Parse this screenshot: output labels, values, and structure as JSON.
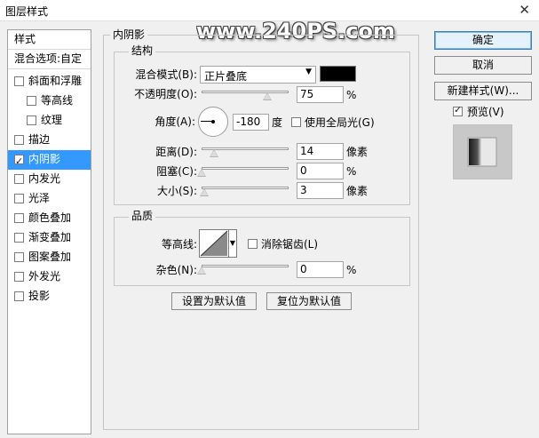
{
  "window": {
    "title": "图层样式",
    "close_glyph": "✕"
  },
  "watermark": "www.240PS.com",
  "left_panel": {
    "header": "样式",
    "blend_options": "混合选项:自定",
    "items": [
      {
        "label": "斜面和浮雕",
        "checked": false
      },
      {
        "label": "等高线",
        "checked": false
      },
      {
        "label": "纹理",
        "checked": false
      },
      {
        "label": "描边",
        "checked": false
      },
      {
        "label": "内阴影",
        "checked": true
      },
      {
        "label": "内发光",
        "checked": false
      },
      {
        "label": "光泽",
        "checked": false
      },
      {
        "label": "颜色叠加",
        "checked": false
      },
      {
        "label": "渐变叠加",
        "checked": false
      },
      {
        "label": "图案叠加",
        "checked": false
      },
      {
        "label": "外发光",
        "checked": false
      },
      {
        "label": "投影",
        "checked": false
      }
    ]
  },
  "inner_shadow": {
    "title": "内阴影",
    "structure": {
      "title": "结构",
      "blend_mode_label": "混合模式(B):",
      "blend_mode_value": "正片叠底",
      "shadow_color": "#000000",
      "opacity_label": "不透明度(O):",
      "opacity_value": "75",
      "opacity_unit": "%",
      "angle_label": "角度(A):",
      "angle_value": "-180",
      "angle_unit": "度",
      "global_light_label": "使用全局光(G)",
      "distance_label": "距离(D):",
      "distance_value": "14",
      "distance_unit": "像素",
      "choke_label": "阻塞(C):",
      "choke_value": "0",
      "choke_unit": "%",
      "size_label": "大小(S):",
      "size_value": "3",
      "size_unit": "像素"
    },
    "quality": {
      "title": "品质",
      "contour_label": "等高线:",
      "antialias_label": "消除锯齿(L)",
      "noise_label": "杂色(N):",
      "noise_value": "0",
      "noise_unit": "%"
    },
    "make_default": "设置为默认值",
    "reset_default": "复位为默认值"
  },
  "right_buttons": {
    "ok": "确定",
    "cancel": "取消",
    "new_style": "新建样式(W)...",
    "preview_label": "预览(V)"
  }
}
